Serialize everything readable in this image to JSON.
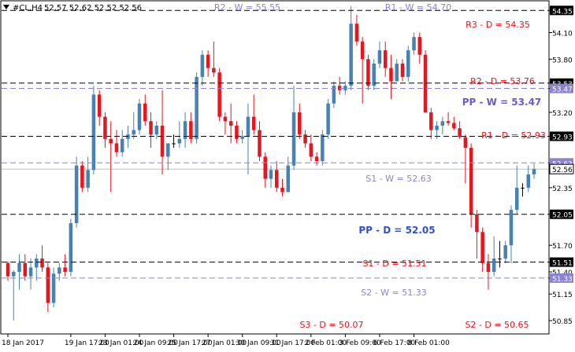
{
  "header": {
    "symbol_text": "#CL,H4",
    "ohlc_text": "52.57 52.62 52.52 52.56"
  },
  "colors": {
    "bull": "#4682b4",
    "bear": "#e8141e",
    "doji": "#000000",
    "daily_label": "#e8141e",
    "weekly_label": "#8c82d2",
    "pp_daily_label": "#2f4fd8",
    "pp_weekly_label": "#6a5acd",
    "daily_line": "#000000",
    "weekly_line": "#8c82d2",
    "price_tag_bg": "#000000",
    "weekly_tag_bg": "#8c82d2",
    "current_tag_bg": "#ffffff"
  },
  "chart_data": {
    "type": "candlestick",
    "timeframe": "H4",
    "ylim": [
      50.7,
      54.45
    ],
    "y_ticks": [
      54.35,
      54.1,
      53.8,
      53.53,
      53.47,
      53.2,
      52.93,
      52.63,
      52.56,
      52.35,
      52.05,
      51.7,
      51.51,
      51.4,
      51.33,
      51.15,
      50.85
    ],
    "x_tick_labels": [
      {
        "index": 0,
        "label": "18 Jan 2017"
      },
      {
        "index": 11,
        "label": "19 Jan 17:00"
      },
      {
        "index": 17,
        "label": "23 Jan 01:00"
      },
      {
        "index": 23,
        "label": "24 Jan 09:00"
      },
      {
        "index": 29,
        "label": "25 Jan 17:00"
      },
      {
        "index": 35,
        "label": "27 Jan 01:00"
      },
      {
        "index": 41,
        "label": "30 Jan 09:00"
      },
      {
        "index": 47,
        "label": "31 Jan 17:00"
      },
      {
        "index": 53,
        "label": "2 Feb 01:00"
      },
      {
        "index": 59,
        "label": "3 Feb 09:00"
      },
      {
        "index": 65,
        "label": "6 Feb 17:00"
      },
      {
        "index": 71,
        "label": "8 Feb 01:00"
      }
    ],
    "candles": [
      [
        51.5,
        51.52,
        51.3,
        51.35
      ],
      [
        51.35,
        51.42,
        50.85,
        51.4
      ],
      [
        51.4,
        51.6,
        51.2,
        51.5
      ],
      [
        51.5,
        51.6,
        51.3,
        51.35
      ],
      [
        51.35,
        51.55,
        51.2,
        51.45
      ],
      [
        51.45,
        51.6,
        51.3,
        51.55
      ],
      [
        51.55,
        51.7,
        51.4,
        51.45
      ],
      [
        51.45,
        51.5,
        50.95,
        51.05
      ],
      [
        51.05,
        51.45,
        51.0,
        51.38
      ],
      [
        51.38,
        51.5,
        51.3,
        51.45
      ],
      [
        51.45,
        51.6,
        51.35,
        51.4
      ],
      [
        51.4,
        52.0,
        51.35,
        51.95
      ],
      [
        51.95,
        52.7,
        51.9,
        52.6
      ],
      [
        52.6,
        52.65,
        52.3,
        52.35
      ],
      [
        52.35,
        52.7,
        52.3,
        52.55
      ],
      [
        52.55,
        53.5,
        52.5,
        53.4
      ],
      [
        53.4,
        53.45,
        53.05,
        53.15
      ],
      [
        53.15,
        53.2,
        52.8,
        52.9
      ],
      [
        52.9,
        53.1,
        52.3,
        52.85
      ],
      [
        52.85,
        53.0,
        52.7,
        52.75
      ],
      [
        52.75,
        53.0,
        52.7,
        52.9
      ],
      [
        52.9,
        53.05,
        52.8,
        52.95
      ],
      [
        52.95,
        53.2,
        52.9,
        53.0
      ],
      [
        53.0,
        53.35,
        52.95,
        53.3
      ],
      [
        53.3,
        53.4,
        53.05,
        53.1
      ],
      [
        53.1,
        53.2,
        52.8,
        52.95
      ],
      [
        52.95,
        53.1,
        52.9,
        53.05
      ],
      [
        53.05,
        53.45,
        52.5,
        52.7
      ],
      [
        52.7,
        52.85,
        52.55,
        52.85
      ],
      [
        52.85,
        52.95,
        52.8,
        52.85
      ],
      [
        52.85,
        53.1,
        52.8,
        52.9
      ],
      [
        52.9,
        53.2,
        52.8,
        53.1
      ],
      [
        53.1,
        53.2,
        52.85,
        52.9
      ],
      [
        52.9,
        53.65,
        52.85,
        53.6
      ],
      [
        53.6,
        53.9,
        53.5,
        53.85
      ],
      [
        53.85,
        53.9,
        53.6,
        53.7
      ],
      [
        53.7,
        54.0,
        53.6,
        53.65
      ],
      [
        53.65,
        53.7,
        53.1,
        53.15
      ],
      [
        53.15,
        53.2,
        52.95,
        53.1
      ],
      [
        53.1,
        53.3,
        52.85,
        53.05
      ],
      [
        53.05,
        53.1,
        52.85,
        52.9
      ],
      [
        52.9,
        53.0,
        52.85,
        52.93
      ],
      [
        52.93,
        53.3,
        52.5,
        53.15
      ],
      [
        53.15,
        53.4,
        52.95,
        53.0
      ],
      [
        53.0,
        53.1,
        52.65,
        52.7
      ],
      [
        52.7,
        52.75,
        52.35,
        52.45
      ],
      [
        52.45,
        52.6,
        52.35,
        52.55
      ],
      [
        52.55,
        52.65,
        52.3,
        52.35
      ],
      [
        52.35,
        52.45,
        52.25,
        52.3
      ],
      [
        52.3,
        52.7,
        52.3,
        52.6
      ],
      [
        52.6,
        53.5,
        52.55,
        53.2
      ],
      [
        53.2,
        53.3,
        52.9,
        52.95
      ],
      [
        52.95,
        53.0,
        52.8,
        52.85
      ],
      [
        52.85,
        52.95,
        52.65,
        52.7
      ],
      [
        52.7,
        52.75,
        52.6,
        52.65
      ],
      [
        52.65,
        53.0,
        52.6,
        52.95
      ],
      [
        52.95,
        53.35,
        52.9,
        53.3
      ],
      [
        53.3,
        53.55,
        53.25,
        53.5
      ],
      [
        53.5,
        53.6,
        53.4,
        53.45
      ],
      [
        53.45,
        53.55,
        53.4,
        53.5
      ],
      [
        53.5,
        54.4,
        53.45,
        54.2
      ],
      [
        54.2,
        54.3,
        53.95,
        54.0
      ],
      [
        54.0,
        54.05,
        53.3,
        53.8
      ],
      [
        53.8,
        53.85,
        53.45,
        53.5
      ],
      [
        53.5,
        53.8,
        53.45,
        53.75
      ],
      [
        53.75,
        54.0,
        53.7,
        53.9
      ],
      [
        53.9,
        54.0,
        53.6,
        53.7
      ],
      [
        53.7,
        53.85,
        53.35,
        53.55
      ],
      [
        53.55,
        53.8,
        53.55,
        53.75
      ],
      [
        53.75,
        53.8,
        53.55,
        53.6
      ],
      [
        53.6,
        53.95,
        53.55,
        53.9
      ],
      [
        53.9,
        54.1,
        53.85,
        54.05
      ],
      [
        54.05,
        54.1,
        53.75,
        53.85
      ],
      [
        53.85,
        53.9,
        53.2,
        53.2
      ],
      [
        53.2,
        53.25,
        52.9,
        53.0
      ],
      [
        53.0,
        53.1,
        52.9,
        53.05
      ],
      [
        53.05,
        53.15,
        52.95,
        53.1
      ],
      [
        53.1,
        53.2,
        53.05,
        53.08
      ],
      [
        53.08,
        53.15,
        53.0,
        53.02
      ],
      [
        53.02,
        53.1,
        52.9,
        52.92
      ],
      [
        52.92,
        52.95,
        52.4,
        52.8
      ],
      [
        52.8,
        52.85,
        51.9,
        52.05
      ],
      [
        52.05,
        52.1,
        51.55,
        51.85
      ],
      [
        51.85,
        51.9,
        51.4,
        51.5
      ],
      [
        51.5,
        51.6,
        51.2,
        51.4
      ],
      [
        51.4,
        51.8,
        51.35,
        51.55
      ],
      [
        51.55,
        51.75,
        51.45,
        51.55
      ],
      [
        51.55,
        51.75,
        51.5,
        51.7
      ],
      [
        51.7,
        52.15,
        51.5,
        52.1
      ],
      [
        52.1,
        52.6,
        52.05,
        52.35
      ],
      [
        52.35,
        52.4,
        52.25,
        52.35
      ],
      [
        52.35,
        52.6,
        52.3,
        52.5
      ],
      [
        52.5,
        52.62,
        52.45,
        52.56
      ]
    ],
    "daily_pivots": [
      {
        "label": "R3 - D = 54.35",
        "value": 54.35,
        "price_tag": "54.35"
      },
      {
        "label": "R2 - D = 53.76",
        "value": 53.53,
        "price_tag": "53.53"
      },
      {
        "label": "R1 - D = 52.93",
        "value": 52.93,
        "price_tag": "52.93"
      },
      {
        "label": "PP - D = 52.05",
        "value": 52.05,
        "price_tag": "52.05"
      },
      {
        "label": "S1 - D = 51.51",
        "value": 51.51,
        "price_tag": "51.51"
      },
      {
        "label": "S2 - D = 50.65",
        "value": null,
        "price_tag": null
      },
      {
        "label": "S3 - D = 50.07",
        "value": null,
        "price_tag": null
      }
    ],
    "weekly_pivots": [
      {
        "label": "R2 - W = 55.55",
        "value": null,
        "price_tag": null
      },
      {
        "label": "R1 - W = 54.70",
        "value": null,
        "price_tag": null
      },
      {
        "label": "PP - W = 53.47",
        "value": 53.47,
        "price_tag": "53.47"
      },
      {
        "label": "S1 - W = 52.63",
        "value": 52.63,
        "price_tag": "52.63"
      },
      {
        "label": "S2 - W = 51.33",
        "value": 51.33,
        "price_tag": "51.33"
      }
    ],
    "current_price": 52.56
  }
}
